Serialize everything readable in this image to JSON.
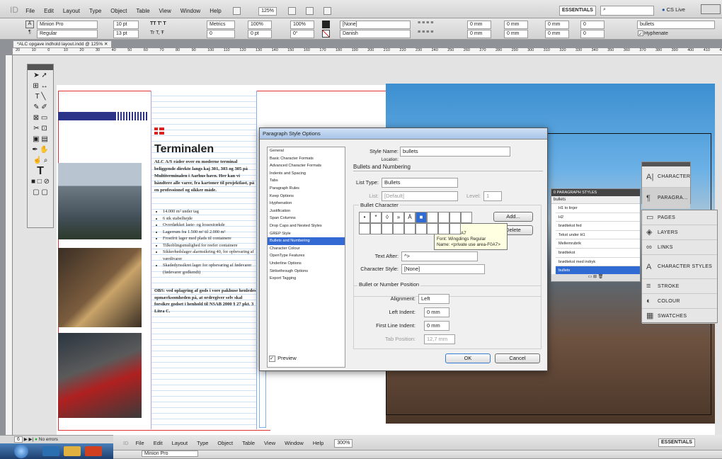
{
  "menu": {
    "items": [
      "File",
      "Edit",
      "Layout",
      "Type",
      "Object",
      "Table",
      "View",
      "Window",
      "Help"
    ],
    "zoom": "125%",
    "workspace": "ESSENTIALS",
    "cslive": "CS Live"
  },
  "control": {
    "font": "Minion Pro",
    "style": "Regular",
    "size": "10 pt",
    "leading": "13 pt",
    "kerning": "Metrics",
    "tracking": "0",
    "hscale": "100%",
    "vscale": "100%",
    "baseline": "0 pt",
    "skew": "0°",
    "charstyle": "[None]",
    "language": "Danish",
    "indent": "0 mm",
    "pstyle": "bullets",
    "hyphenate": "Hyphenate"
  },
  "doc": {
    "tab": "*ALC opgave indhold layout.indd @ 125%",
    "ruler": [
      "20",
      "10",
      "0",
      "10",
      "20",
      "30",
      "40",
      "50",
      "60",
      "70",
      "80",
      "90",
      "100",
      "110",
      "120",
      "130",
      "140",
      "150",
      "160",
      "170",
      "180",
      "190",
      "200",
      "210",
      "220",
      "230",
      "240",
      "250",
      "260",
      "270",
      "280",
      "290",
      "300",
      "310",
      "320",
      "330",
      "340",
      "350",
      "360",
      "370",
      "380",
      "390",
      "400",
      "410",
      "420"
    ],
    "heading": "Terminalen",
    "intro": "ALC A/S råder over en moderne terminal beliggende direkte langs kaj 301, 303 og 305 på Multiterminalen i Aarhus havn. Her kan vi håndtere alle varer, fra kartoner til projektlast, på en professionel og sikker måde.",
    "bullets": [
      "14.000 m² under tag",
      "6 stk stabelhejde",
      "Overdækket laste- og lossestrækde",
      "Lagerrum fra 1.500 m² til 2.000 m²",
      "Frostfrit lager med plads til containere",
      "Tilkoblingsmulighed for reefer containere",
      "Sikkerhedslager alarmsikring 40, for opbevaring af værdivarer",
      "Skadedyrssikret lager for opbevaring af fødevarer (fødevarer godkendt)"
    ],
    "obs": "OBS: ved oplagring af gods i vore pakhuse henledes opmærksomheden på, at ordregiver selv skal forsikre godset i henhold til NSAB 2000 § 27 pkt. 3 Litra C."
  },
  "dialog": {
    "title": "Paragraph Style Options",
    "categories": [
      "General",
      "Basic Character Formats",
      "Advanced Character Formats",
      "Indents and Spacing",
      "Tabs",
      "Paragraph Rules",
      "Keep Options",
      "Hyphenation",
      "Justification",
      "Span Columns",
      "Drop Caps and Nested Styles",
      "GREP Style",
      "Bullets and Numbering",
      "Character Colour",
      "OpenType Features",
      "Underline Options",
      "Strikethrough Options",
      "Export Tagging"
    ],
    "style_name_label": "Style Name:",
    "style_name": "bullets",
    "location_label": "Location:",
    "section": "Bullets and Numbering",
    "list_type_label": "List Type:",
    "list_type": "Bullets",
    "list_label": "List:",
    "list": "[Default]",
    "level_label": "Level:",
    "level": "1",
    "bullet_char": "Bullet Character",
    "bullet_glyphs": [
      "•",
      "*",
      "◊",
      "»",
      "Ä",
      "■",
      "",
      "",
      "",
      "",
      "",
      "",
      "",
      "",
      "",
      "",
      "",
      "",
      ""
    ],
    "add": "Add...",
    "delete": "Delete",
    "tooltip": [
      "GID: 131",
      "Unicode: F0A7",
      "Font: Wingdings Regular",
      "Name: <private use area-F0A7>"
    ],
    "text_after_label": "Text After:",
    "text_after": "^>",
    "char_style_label": "Character Style:",
    "char_style": "[None]",
    "position_section": "Bullet or Number Position",
    "align_label": "Alignment:",
    "align": "Left",
    "left_indent_label": "Left Indent:",
    "left_indent": "0 mm",
    "first_indent_label": "First Line Indent:",
    "first_indent": "0 mm",
    "tab_pos_label": "Tab Position:",
    "tab_pos": "12,7 mm",
    "preview": "Preview",
    "ok": "OK",
    "cancel": "Cancel"
  },
  "pstyles": {
    "title": "0 PARAGRAPH STYLES",
    "current": "bullets",
    "items": [
      "H1 to linjer",
      "H2",
      "brødtekst fed",
      "Tekst under H1",
      "Mellemrubrik",
      "brødtekst",
      "brødtekst med indryk",
      "bullets"
    ]
  },
  "sidepanel": {
    "top": [
      "CHARACTER",
      "PARAGRA..."
    ],
    "items": [
      "PAGES",
      "LAYERS",
      "LINKS",
      "CHARACTER STYLES",
      "STROKE",
      "COLOUR",
      "SWATCHES"
    ]
  },
  "status": {
    "page": "6",
    "errors": "No errors",
    "zoom2": "300%"
  },
  "colors": {
    "accent": "#2f6bd2",
    "margin": "#d33",
    "guide": "#7fb0e8"
  }
}
